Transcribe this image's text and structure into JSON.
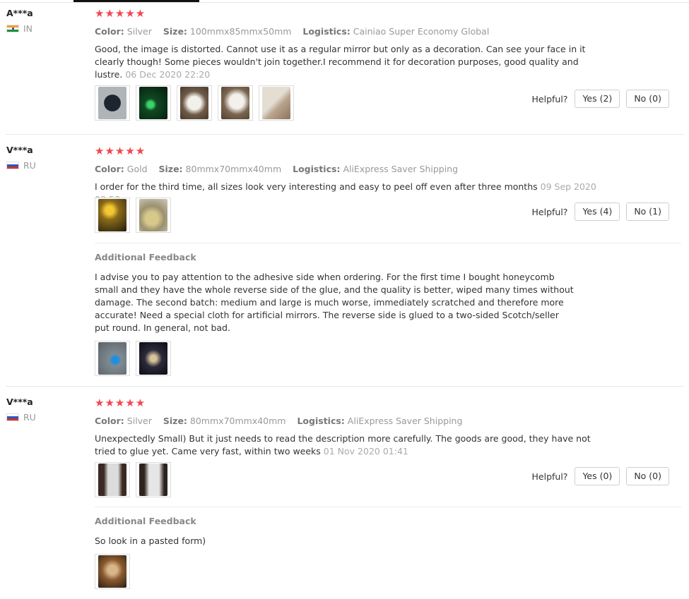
{
  "reviews": [
    {
      "user": "A***a",
      "country": "IN",
      "rating": "★★★★★",
      "color_label": "Color:",
      "color": "Silver",
      "size_label": "Size:",
      "size": "100mmx85mmx50mm",
      "logistics_label": "Logistics:",
      "logistics": "Cainiao Super Economy Global",
      "text": "Good, the image is distorted. Cannot use it as a regular mirror but only as a decoration. Can see your face in it clearly though! Some pieces wouldn't join together.I recommend it for decoration purposes, good quality and lustre.",
      "date": "06 Dec 2020 22:20",
      "helpful_label": "Helpful?",
      "yes": "Yes (2)",
      "no": "No (0)"
    },
    {
      "user": "V***a",
      "country": "RU",
      "rating": "★★★★★",
      "color_label": "Color:",
      "color": "Gold",
      "size_label": "Size:",
      "size": "80mmx70mmx40mm",
      "logistics_label": "Logistics:",
      "logistics": "AliExpress Saver Shipping",
      "text": "I order for the third time, all sizes look very interesting and easy to peel off even after three months",
      "date": "09 Sep 2020 03:53",
      "helpful_label": "Helpful?",
      "yes": "Yes (4)",
      "no": "No (1)",
      "additional_heading": "Additional Feedback",
      "additional_text": "I advise you to pay attention to the adhesive side when ordering. For the first time I bought honeycomb small and they have the whole reverse side of the glue, and the quality is better, wiped many times without damage. The second batch: medium and large is much worse, immediately scratched and therefore more accurate! Need a special cloth for artificial mirrors. The reverse side is glued to a two-sided Scotch/seller put round. In general, not bad."
    },
    {
      "user": "V***a",
      "country": "RU",
      "rating": "★★★★★",
      "color_label": "Color:",
      "color": "Silver",
      "size_label": "Size:",
      "size": "80mmx70mmx40mm",
      "logistics_label": "Logistics:",
      "logistics": "AliExpress Saver Shipping",
      "text": "Unexpectedly Small) But it just needs to read the description more carefully. The goods are good, they have not tried to glue yet. Came very fast, within two weeks",
      "date": "01 Nov 2020 01:41",
      "helpful_label": "Helpful?",
      "yes": "Yes (0)",
      "no": "No (0)",
      "additional_heading": "Additional Feedback",
      "additional_text": "So look in a pasted form)"
    }
  ],
  "colors": {
    "star": "#f0474e",
    "divider": "#e8e8e8",
    "muted": "#999999"
  }
}
